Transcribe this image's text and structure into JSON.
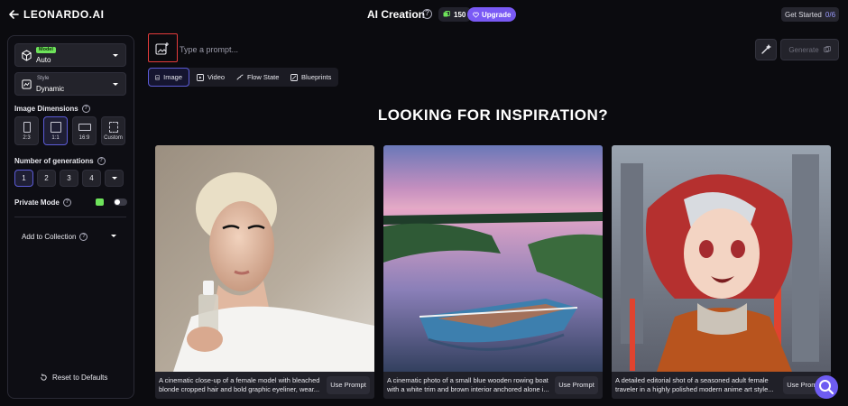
{
  "header": {
    "brand": "LEONARDO.AI",
    "title": "AI Creation",
    "tokens": "150",
    "upgrade_label": "Upgrade",
    "get_started_label": "Get Started",
    "get_started_count": "0/6"
  },
  "sidebar": {
    "model": {
      "badge": "Model",
      "value": "Auto"
    },
    "style": {
      "label": "Style",
      "value": "Dynamic"
    },
    "dimensions_label": "Image Dimensions",
    "dimensions": [
      "2:3",
      "1:1",
      "16:9",
      "Custom"
    ],
    "dimensions_selected": "1:1",
    "generations_label": "Number of generations",
    "generations": [
      "1",
      "2",
      "3",
      "4"
    ],
    "generations_selected": "1",
    "private_mode_label": "Private Mode",
    "collection_label": "Add to Collection",
    "reset_label": "Reset to Defaults"
  },
  "prompt": {
    "placeholder": "Type a prompt...",
    "generate_label": "Generate"
  },
  "tabs": [
    {
      "label": "Image",
      "active": true
    },
    {
      "label": "Video"
    },
    {
      "label": "Flow State"
    },
    {
      "label": "Blueprints"
    }
  ],
  "hero_title": "LOOKING FOR INSPIRATION?",
  "cards": [
    {
      "caption": "A cinematic close-up of a female model with bleached blonde cropped hair and bold graphic eyeliner, wear...",
      "button": "Use Prompt"
    },
    {
      "caption": "A cinematic photo of a small blue wooden rowing boat with a white trim and brown interior anchored alone i...",
      "button": "Use Prompt"
    },
    {
      "caption": "A detailed editorial shot of a seasoned adult female traveler in a highly polished modern anime art style...",
      "button": "Use Prompt"
    }
  ],
  "colors": {
    "accent": "#5b5bd6",
    "upgrade": "#7a5af5",
    "model_badge": "#6ee35b",
    "highlight_border": "#e43b3b"
  },
  "icons": [
    "back-arrow-icon",
    "help-icon",
    "token-icon",
    "heart-icon",
    "cube-icon",
    "style-icon",
    "image-add-icon",
    "magic-wand-icon",
    "reset-icon",
    "search-icon"
  ]
}
